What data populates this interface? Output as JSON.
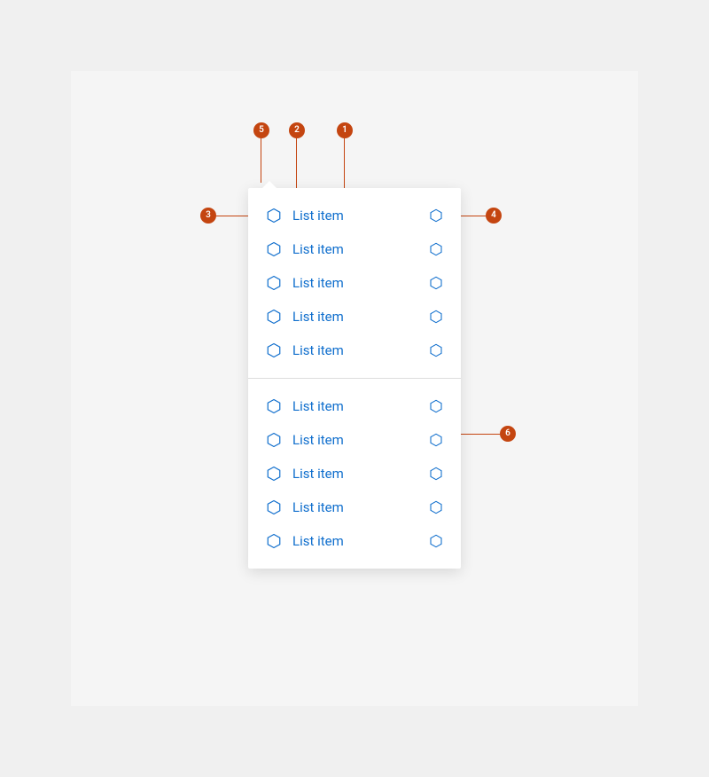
{
  "colors": {
    "accent_blue": "#0f6ecd",
    "annotation_orange": "#c44510",
    "panel_bg": "#ffffff",
    "stage_bg": "#f5f5f5",
    "page_bg": "#f0f0f0",
    "divider": "#dcdcdc"
  },
  "menu": {
    "groups": [
      {
        "items": [
          {
            "label": "List item",
            "leading_icon": "hexagon-icon",
            "trailing_icon": "hexagon-icon"
          },
          {
            "label": "List item",
            "leading_icon": "hexagon-icon",
            "trailing_icon": "hexagon-icon"
          },
          {
            "label": "List item",
            "leading_icon": "hexagon-icon",
            "trailing_icon": "hexagon-icon"
          },
          {
            "label": "List item",
            "leading_icon": "hexagon-icon",
            "trailing_icon": "hexagon-icon"
          },
          {
            "label": "List item",
            "leading_icon": "hexagon-icon",
            "trailing_icon": "hexagon-icon"
          }
        ]
      },
      {
        "items": [
          {
            "label": "List item",
            "leading_icon": "hexagon-icon",
            "trailing_icon": "hexagon-icon"
          },
          {
            "label": "List item",
            "leading_icon": "hexagon-icon",
            "trailing_icon": "hexagon-icon"
          },
          {
            "label": "List item",
            "leading_icon": "hexagon-icon",
            "trailing_icon": "hexagon-icon"
          },
          {
            "label": "List item",
            "leading_icon": "hexagon-icon",
            "trailing_icon": "hexagon-icon"
          },
          {
            "label": "List item",
            "leading_icon": "hexagon-icon",
            "trailing_icon": "hexagon-icon"
          }
        ]
      }
    ]
  },
  "annotations": {
    "1": "1",
    "2": "2",
    "3": "3",
    "4": "4",
    "5": "5",
    "6": "6"
  }
}
